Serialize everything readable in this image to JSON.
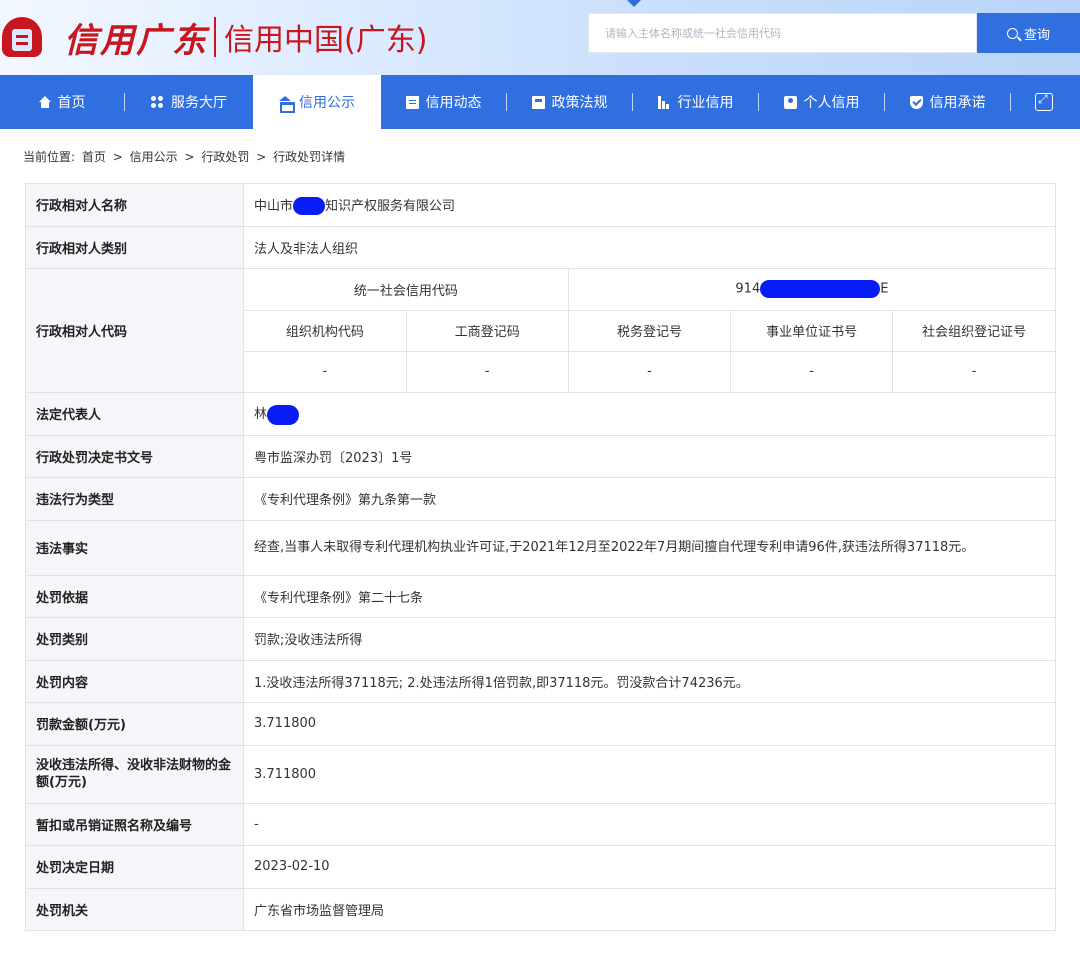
{
  "header": {
    "logo_script": "信用广东",
    "logo_sub": "信用中国(广东)",
    "search_placeholder": "请输入主体名称或统一社会信用代码",
    "search_button": "查询"
  },
  "nav": {
    "items": [
      {
        "label": "首页",
        "icon": "home-icon"
      },
      {
        "label": "服务大厅",
        "icon": "grid-icon"
      },
      {
        "label": "信用公示",
        "icon": "graduation-cap-icon",
        "active": true
      },
      {
        "label": "信用动态",
        "icon": "document-icon"
      },
      {
        "label": "政策法规",
        "icon": "book-icon"
      },
      {
        "label": "行业信用",
        "icon": "bar-chart-icon"
      },
      {
        "label": "个人信用",
        "icon": "person-card-icon"
      },
      {
        "label": "信用承诺",
        "icon": "shield-check-icon"
      }
    ],
    "expand_icon": "expand-icon"
  },
  "breadcrumb": {
    "prefix": "当前位置:",
    "items": [
      "首页",
      ">",
      "信用公示",
      ">",
      "行政处罚",
      ">",
      "行政处罚详情"
    ]
  },
  "detail": {
    "name_label": "行政相对人名称",
    "name_prefix": "中山市",
    "name_suffix": "知识产权服务有限公司",
    "category_label": "行政相对人类别",
    "category_value": "法人及非法人组织",
    "code_label": "行政相对人代码",
    "uscc_label": "统一社会信用代码",
    "uscc_prefix": "914",
    "uscc_suffix": "E",
    "sub_headers": [
      "组织机构代码",
      "工商登记码",
      "税务登记号",
      "事业单位证书号",
      "社会组织登记证号"
    ],
    "sub_values": [
      "-",
      "-",
      "-",
      "-",
      "-"
    ],
    "legal_rep_label": "法定代表人",
    "legal_rep_prefix": "林",
    "decision_no_label": "行政处罚决定书文号",
    "decision_no_value": "粤市监深办罚〔2023〕1号",
    "violation_type_label": "违法行为类型",
    "violation_type_value": "《专利代理条例》第九条第一款",
    "violation_fact_label": "违法事实",
    "violation_fact_value": "经查,当事人未取得专利代理机构执业许可证,于2021年12月至2022年7月期间擅自代理专利申请96件,获违法所得37118元。",
    "basis_label": "处罚依据",
    "basis_value": "《专利代理条例》第二十七条",
    "penalty_type_label": "处罚类别",
    "penalty_type_value": "罚款;没收违法所得",
    "penalty_content_label": "处罚内容",
    "penalty_content_value": "1.没收违法所得37118元; 2.处违法所得1倍罚款,即37118元。罚没款合计74236元。",
    "fine_label": "罚款金额(万元)",
    "fine_value": "3.711800",
    "confiscation_label": "没收违法所得、没收非法财物的金额(万元)",
    "confiscation_value": "3.711800",
    "license_label": "暂扣或吊销证照名称及编号",
    "license_value": "-",
    "decision_date_label": "处罚决定日期",
    "decision_date_value": "2023-02-10",
    "authority_label": "处罚机关",
    "authority_value": "广东省市场监督管理局"
  },
  "colors": {
    "brand_blue": "#2f6fe0",
    "brand_red": "#c8161e",
    "redaction": "#0a1cf5"
  }
}
